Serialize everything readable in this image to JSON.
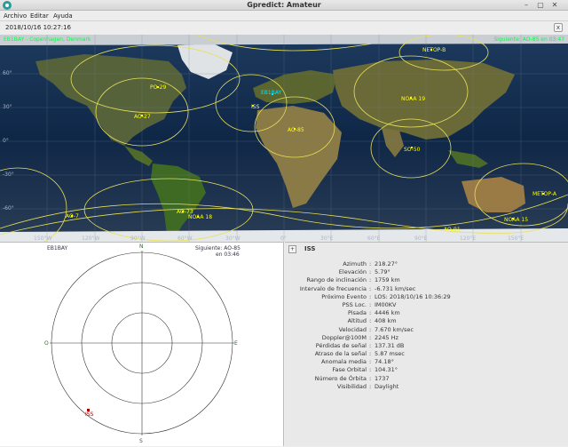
{
  "window": {
    "title": "Gpredict: Amateur",
    "minimize_glyph": "–",
    "maximize_glyph": "▢",
    "close_glyph": "✕"
  },
  "menu": [
    "Archivo",
    "Editar",
    "Ayuda"
  ],
  "toolbar": {
    "datetime": "2018/10/16 10:27:16",
    "close_glyph": "x"
  },
  "map": {
    "station": "EB1BAY - Copenhagen, Denmark",
    "next": "Siguiente: AO-85 en 03:47",
    "lat_labels": [
      "60°",
      "30°",
      "0°",
      "-30°",
      "-60°"
    ],
    "lon_labels": [
      "150°W",
      "120°W",
      "90°W",
      "60°W",
      "30°W",
      "0°",
      "30°E",
      "60°E",
      "90°E",
      "120°E",
      "150°E"
    ],
    "satellites": [
      {
        "name": "NETOP-B",
        "color": "#ffff00"
      },
      {
        "name": "PO-29",
        "color": "#ffff00"
      },
      {
        "name": "EB1BAY",
        "color": "#00e8ff"
      },
      {
        "name": "AO-27",
        "color": "#ffff00"
      },
      {
        "name": "ISS",
        "color": "#ffff00"
      },
      {
        "name": "NOAA 19",
        "color": "#ffff00"
      },
      {
        "name": "AO-85",
        "color": "#ffff00"
      },
      {
        "name": "SO-50",
        "color": "#ffff00"
      },
      {
        "name": "METOP-A",
        "color": "#ffff00"
      },
      {
        "name": "AO-7",
        "color": "#ffff00"
      },
      {
        "name": "AO-73",
        "color": "#ffff00"
      },
      {
        "name": "NOAA 18",
        "color": "#ffff00"
      },
      {
        "name": "NOAA 15",
        "color": "#ffff00"
      },
      {
        "name": "AO-91",
        "color": "#ffff00"
      }
    ]
  },
  "polar": {
    "station": "EB1BAY",
    "next_line1": "Siguiente: AO-85",
    "next_line2": "en 03:46",
    "north": "N",
    "south": "S",
    "east": "E",
    "west": "O",
    "sat_name": "ISS"
  },
  "info": {
    "expander_glyph": "+",
    "title": "ISS",
    "rows": [
      {
        "label": "Azimuth",
        "value": "218.27°"
      },
      {
        "label": "Elevación",
        "value": "5.79°"
      },
      {
        "label": "Rango de inclinación",
        "value": "1759 km"
      },
      {
        "label": "Intervalo de frecuencia",
        "value": "-6.731 km/sec"
      },
      {
        "label": "Próximo Evento",
        "value": "LOS: 2018/10/16 10:36:29"
      },
      {
        "label": "PSS Loc.",
        "value": "IM00KV"
      },
      {
        "label": "Pisada",
        "value": "4446 km"
      },
      {
        "label": "Altitud",
        "value": "408 km"
      },
      {
        "label": "Velocidad",
        "value": "7.670 km/sec"
      },
      {
        "label": "Doppler@100M",
        "value": "2245 Hz"
      },
      {
        "label": "Pérdidas de señal",
        "value": "137.31 dB"
      },
      {
        "label": "Atraso de la señal",
        "value": "5.87 msec"
      },
      {
        "label": "Anomala media",
        "value": "74.18°"
      },
      {
        "label": "Fase Orbital",
        "value": "104.31°"
      },
      {
        "label": "Número de Órbita",
        "value": "1737"
      },
      {
        "label": "Visibilidad",
        "value": "Daylight"
      }
    ]
  }
}
